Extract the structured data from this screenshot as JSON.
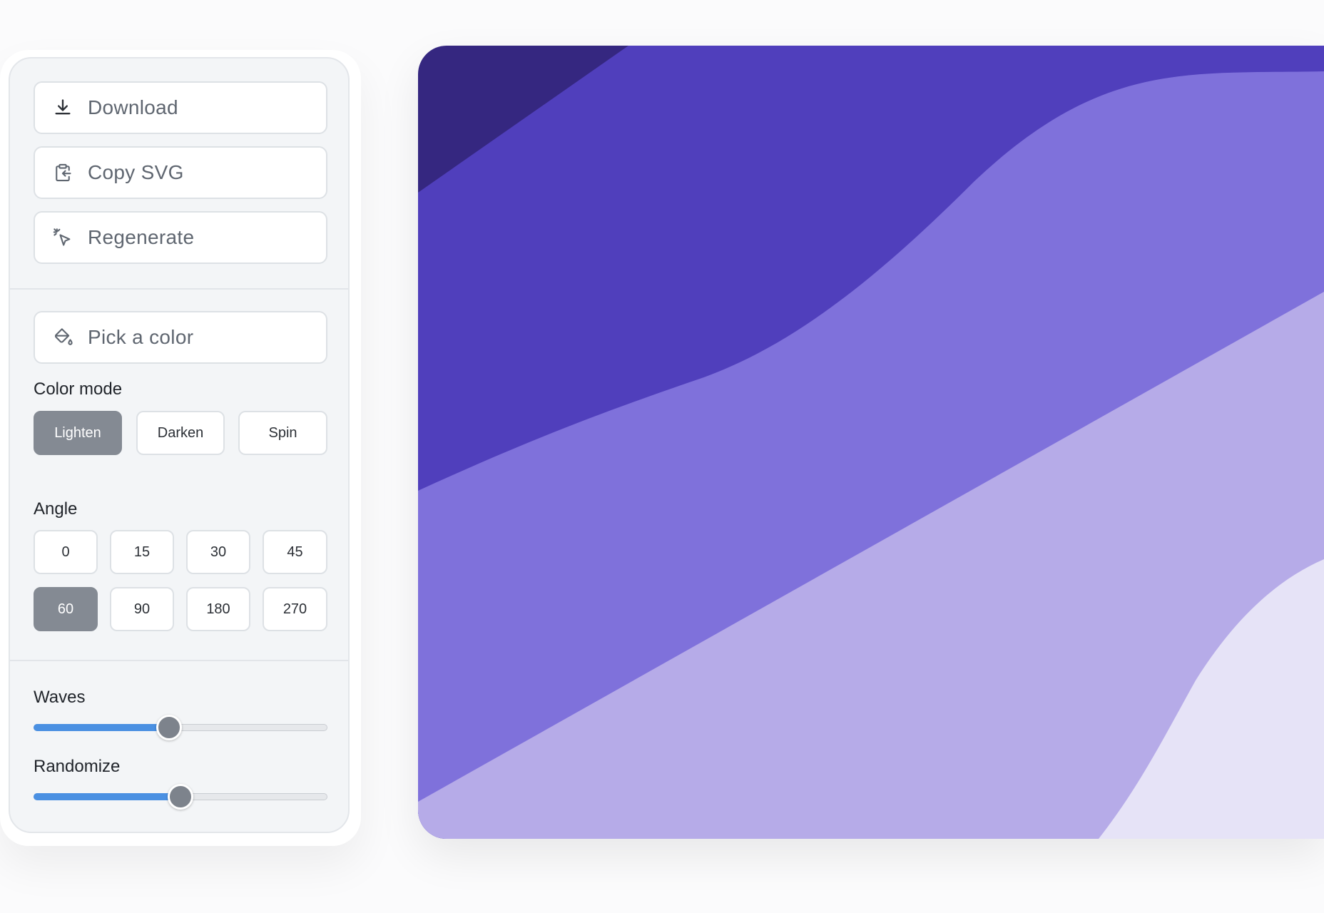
{
  "actions": {
    "download": "Download",
    "copy_svg": "Copy SVG",
    "regenerate": "Regenerate"
  },
  "color_picker": {
    "label": "Pick a color"
  },
  "color_mode": {
    "label": "Color mode",
    "options": [
      "Lighten",
      "Darken",
      "Spin"
    ],
    "selected": "Lighten"
  },
  "angle": {
    "label": "Angle",
    "options": [
      "0",
      "15",
      "30",
      "45",
      "60",
      "90",
      "180",
      "270"
    ],
    "selected": "60"
  },
  "waves": {
    "label": "Waves",
    "value_fraction": 0.46
  },
  "randomize": {
    "label": "Randomize",
    "value_fraction": 0.5
  },
  "preview": {
    "colors": [
      "#352780",
      "#503fbc",
      "#7f71db",
      "#b6abe8",
      "#e6e3f7"
    ]
  }
}
